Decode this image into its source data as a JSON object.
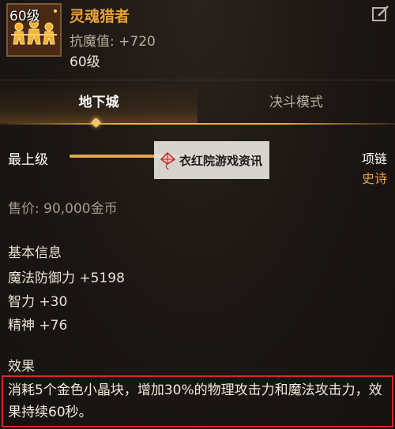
{
  "item": {
    "icon_level": "60级",
    "icon_name": "soul-hunter-item-icon",
    "name": "灵魂猎者",
    "resist": "抗魔值: +720",
    "level": "60级",
    "name_color": "#e8a13a"
  },
  "tabs": [
    {
      "label": "地下城",
      "active": true
    },
    {
      "label": "决斗模式",
      "active": false
    }
  ],
  "grade": {
    "label": "最上级",
    "fill_fraction": 1.0
  },
  "slot": {
    "type": "项链",
    "rarity": "史诗",
    "rarity_color": "#e8a13a"
  },
  "watermark": {
    "text": "衣红院游戏资讯",
    "icon_name": "kite-icon"
  },
  "price": "售价: 90,000金币",
  "basic_info": {
    "title": "基本信息",
    "stats": [
      "魔法防御力 +5198",
      "智力 +30",
      "精神 +76"
    ]
  },
  "effect": {
    "title": "效果",
    "text": "消耗5个金色小晶块，增加30%的物理攻击力和魔法攻击力，效果持续60秒。",
    "highlight_color": "#d42a2a"
  }
}
